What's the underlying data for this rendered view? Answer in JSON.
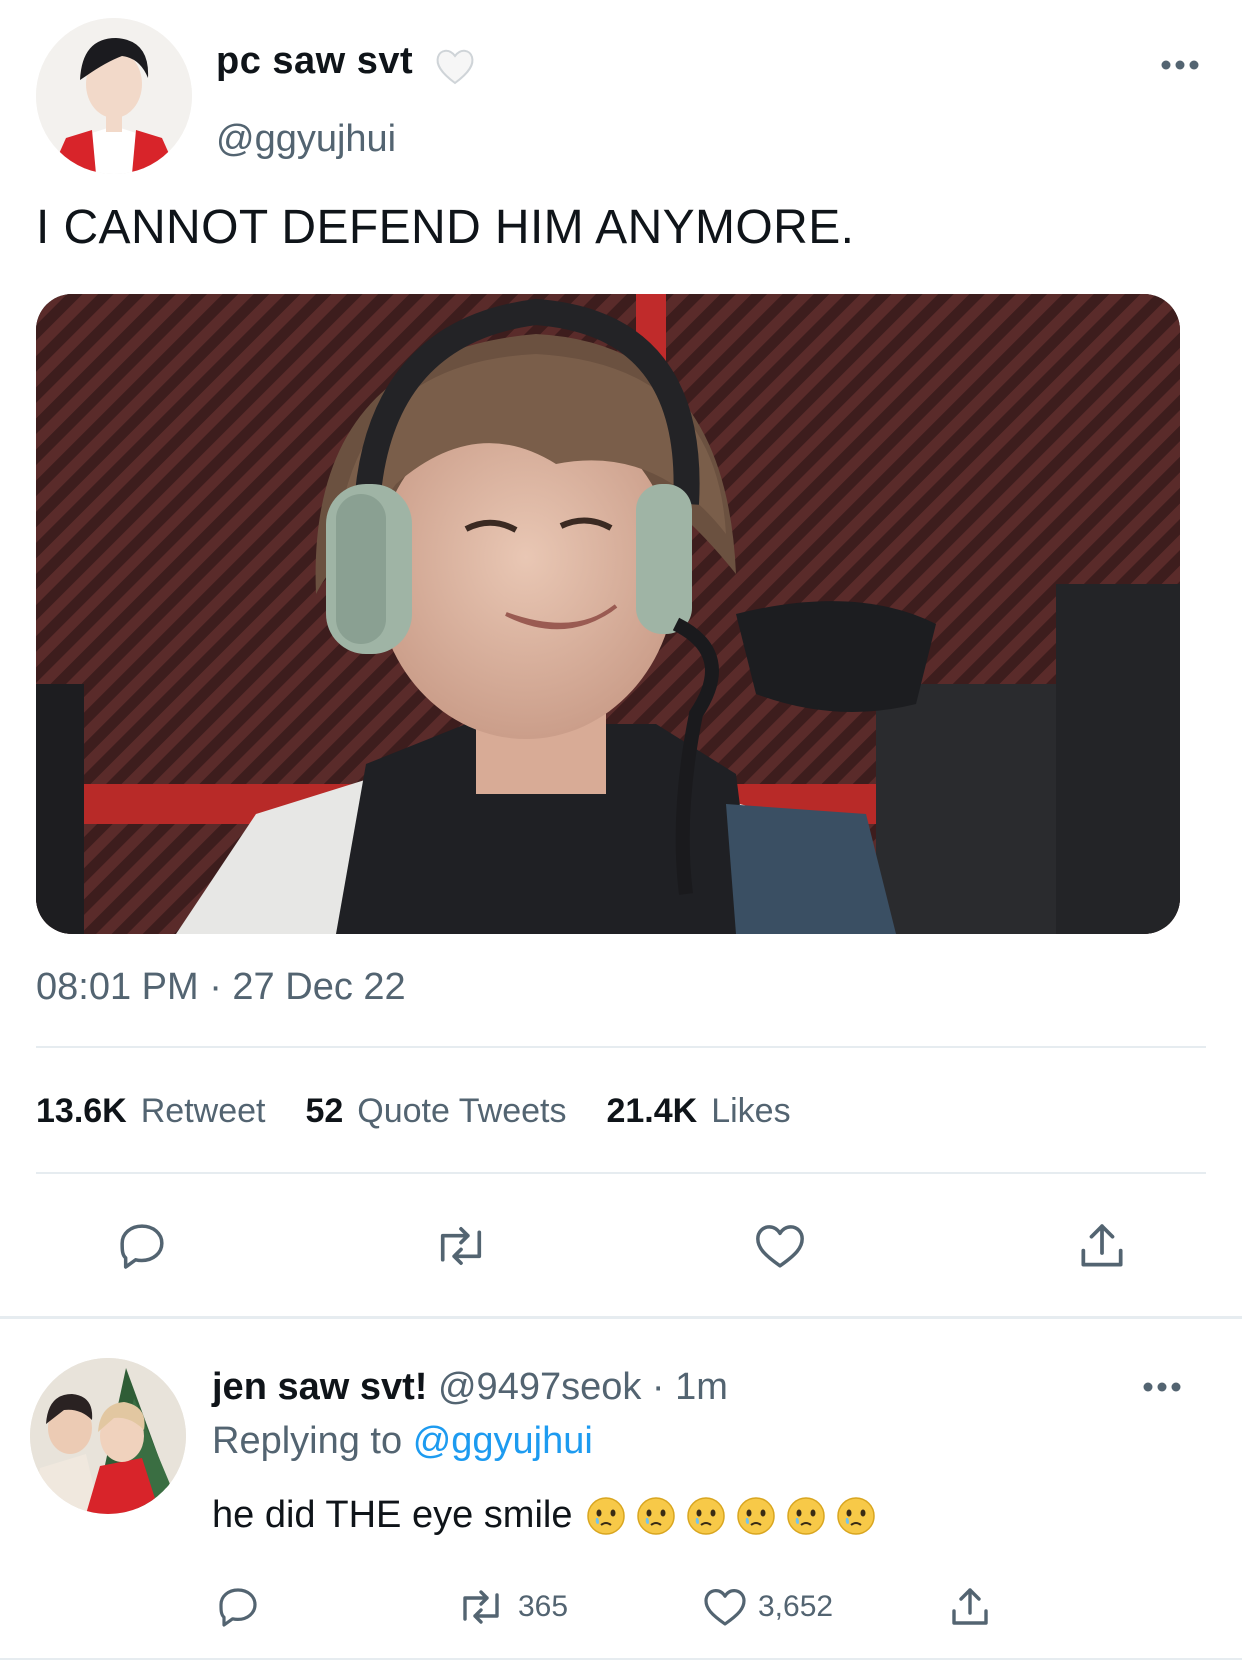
{
  "tweet": {
    "display_name": "pc saw svt",
    "name_emoji": "white-heart-emoji",
    "handle": "@ggyujhui",
    "text": "I CANNOT DEFEND HIM ANYMORE.",
    "media_description_icon": "photo",
    "timestamp": "08:01 PM · 27 Dec 22",
    "stats": {
      "retweets_count": "13.6K",
      "retweets_label": "Retweet",
      "quotes_count": "52",
      "quotes_label": "Quote Tweets",
      "likes_count": "21.4K",
      "likes_label": "Likes"
    },
    "actions": [
      "reply-icon",
      "retweet-icon",
      "like-icon",
      "share-icon"
    ]
  },
  "reply": {
    "display_name": "jen saw svt!",
    "meta": "@9497seok · 1m",
    "replying_prefix": "Replying to",
    "replying_handle": "@ggyujhui",
    "text": "he did THE eye smile",
    "emoji_count": 6,
    "emoji_name": "face-holding-back-tears-emoji",
    "retweet_count": "365",
    "like_count": "3,652"
  },
  "colors": {
    "text": "#0f1419",
    "secondary": "#536471",
    "link": "#1d9bf0",
    "divider": "#e6ecf0"
  }
}
